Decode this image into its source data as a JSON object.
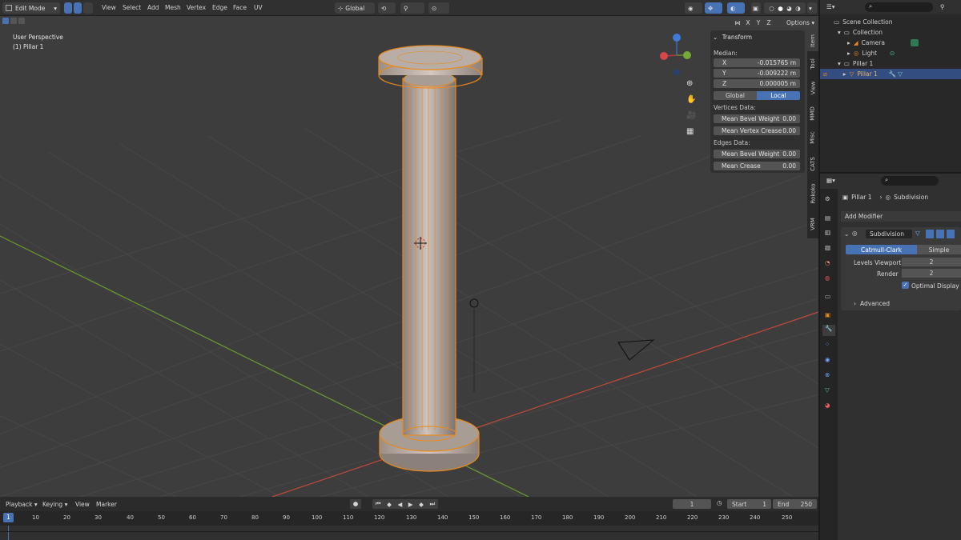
{
  "header": {
    "mode": "Edit Mode",
    "menus": [
      "View",
      "Select",
      "Add",
      "Mesh",
      "Vertex",
      "Edge",
      "Face",
      "UV"
    ],
    "orientation": "Global",
    "xyz": [
      "X",
      "Y",
      "Z"
    ],
    "options": "Options"
  },
  "viewport": {
    "overlay_line1": "User Perspective",
    "overlay_line2": "(1) Pillar 1",
    "gizmo_axes": [
      "Y",
      "X",
      "Z"
    ]
  },
  "npanel": {
    "section": "Transform",
    "median_label": "Median:",
    "x_label": "X",
    "x_value": "-0.015765 m",
    "y_label": "Y",
    "y_value": "-0.009222 m",
    "z_label": "Z",
    "z_value": "0.000005 m",
    "global": "Global",
    "local": "Local",
    "vertices_data": "Vertices Data:",
    "mean_bevel_weight_v": "Mean Bevel Weight",
    "mean_bevel_weight_v_val": "0.00",
    "mean_vertex_crease": "Mean Vertex Crease",
    "mean_vertex_crease_val": "0.00",
    "edges_data": "Edges Data:",
    "mean_bevel_weight_e": "Mean Bevel Weight",
    "mean_bevel_weight_e_val": "0.00",
    "mean_crease": "Mean Crease",
    "mean_crease_val": "0.00",
    "tabs": [
      "Item",
      "Tool",
      "View",
      "MMD",
      "Misc",
      "CATS",
      "Rokoko",
      "VRM"
    ]
  },
  "outliner": {
    "scene_collection": "Scene Collection",
    "collection": "Collection",
    "camera": "Camera",
    "light": "Light",
    "pillar_parent": "Pillar 1",
    "pillar_child": "Pillar 1"
  },
  "properties": {
    "breadcrumb_obj": "Pillar 1",
    "breadcrumb_mod": "Subdivision",
    "add_modifier": "Add Modifier",
    "modifier_name": "Subdivision",
    "catmull": "Catmull-Clark",
    "simple": "Simple",
    "levels_viewport": "Levels Viewport",
    "levels_viewport_val": "2",
    "render": "Render",
    "render_val": "2",
    "optimal_display": "Optimal Display",
    "advanced": "Advanced"
  },
  "timeline": {
    "menus": [
      "Playback",
      "Keying",
      "View",
      "Marker"
    ],
    "current_frame": "1",
    "start_label": "Start",
    "start_val": "1",
    "end_label": "End",
    "end_val": "250",
    "ticks": [
      "1",
      "10",
      "20",
      "30",
      "40",
      "50",
      "60",
      "70",
      "80",
      "90",
      "100",
      "110",
      "120",
      "130",
      "140",
      "150",
      "160",
      "170",
      "180",
      "190",
      "200",
      "210",
      "220",
      "230",
      "240",
      "250"
    ]
  },
  "colors": {
    "accent": "#4772b3",
    "selection_orange": "#e8891c",
    "x_axis": "#c04a3a",
    "y_axis": "#6a9a32"
  }
}
